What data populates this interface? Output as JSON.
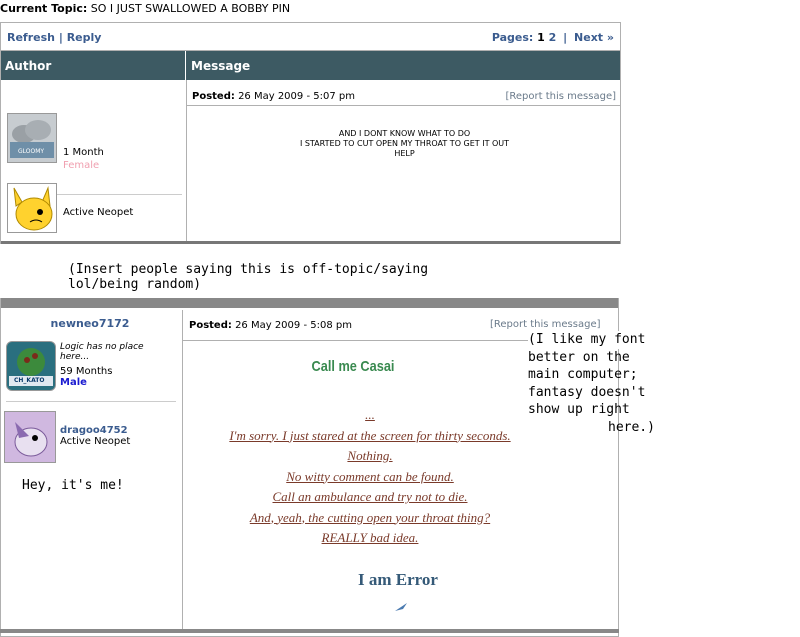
{
  "topic": {
    "label": "Current Topic:",
    "value": "SO I JUST SWALLOWED A BOBBY PIN"
  },
  "toolbar": {
    "refresh": "Refresh",
    "sep": "|",
    "reply": "Reply",
    "pages_label": "Pages:",
    "page1": "1",
    "page2": "2",
    "next": "Next »"
  },
  "table": {
    "author_header": "Author",
    "message_header": "Message"
  },
  "post1": {
    "posted_label": "Posted:",
    "posted_value": "26 May 2009 - 5:07 pm",
    "report": "[Report this message]",
    "author1": {
      "age": "1 Month",
      "gender": "Female",
      "avatar_text": "GLOOMY"
    },
    "author2": {
      "title": "Active Neopet"
    },
    "lines": [
      "AND I DONT KNOW WHAT TO DO",
      "I STARTED TO CUT OPEN MY THROAT TO GET IT OUT",
      "HELP"
    ]
  },
  "insert_note": [
    "(Insert people saying this is off-topic/saying",
    "lol/being random)"
  ],
  "post2": {
    "username": "newneo7172",
    "quote": [
      "Logic has no place",
      "here..."
    ],
    "age": "59 Months",
    "gender": "Male",
    "avatar_text": "CH_KATO",
    "pet_name": "dragoo4752",
    "pet_title": "Active Neopet",
    "hey": "Hey, it's me!",
    "posted_label": "Posted:",
    "posted_value": "26 May 2009 - 5:08 pm",
    "report": "[Report this message]",
    "call_me": "Call me Casai",
    "ellipsis": "...",
    "lines": [
      "I'm sorry. I just stared at the screen for thirty seconds.",
      "Nothing.",
      "No witty comment can be found.",
      "Call an ambulance and try not to die.",
      "And, yeah, the cutting open your throat thing?",
      "REALLY bad idea."
    ],
    "signoff": "I am Error"
  },
  "side_note": [
    "(I like my font",
    "better on the",
    "main computer;",
    "fantasy doesn't",
    "show up right",
    "here.)"
  ],
  "colors": {
    "header_bg": "#3d5a63",
    "link": "#3b5c8f",
    "female": "#f0a0b0",
    "male": "#1a1ad0",
    "post_text": "#7a3a2a",
    "casai": "#3a8a50",
    "error": "#355a78"
  }
}
